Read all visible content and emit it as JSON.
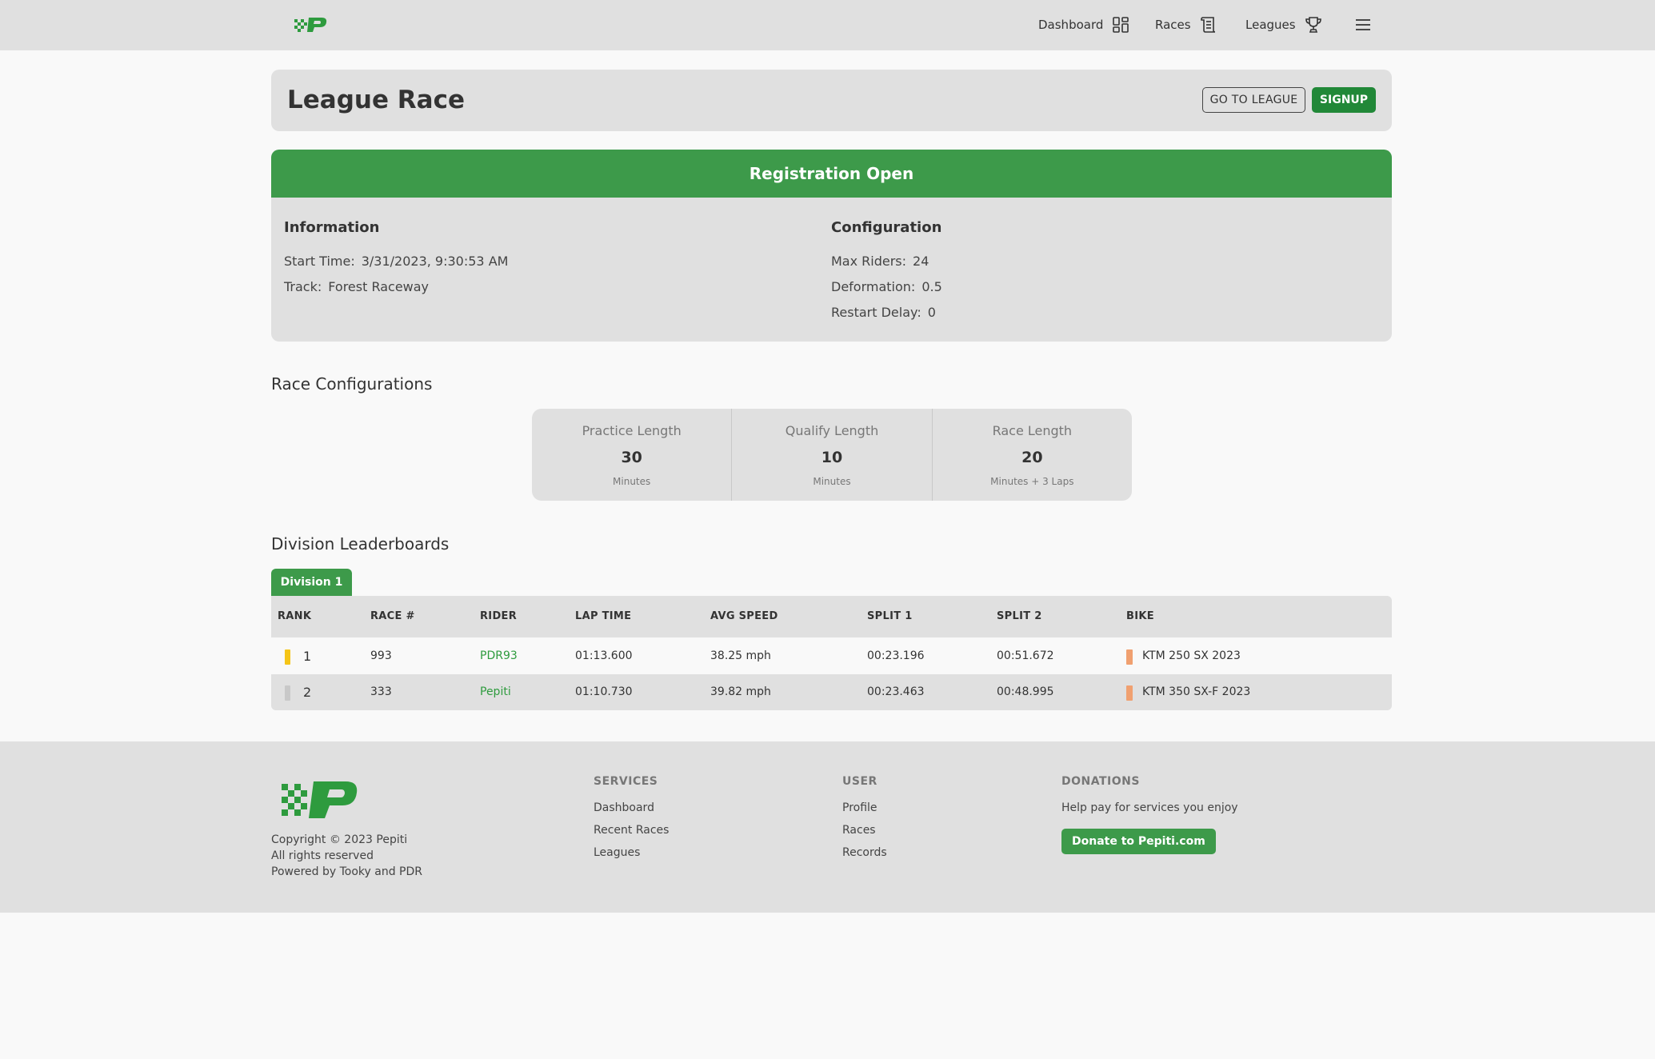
{
  "nav": {
    "logo": "pepiti-logo",
    "items": [
      {
        "label": "Dashboard",
        "icon": "dashboard-icon"
      },
      {
        "label": "Races",
        "icon": "scroll-icon"
      },
      {
        "label": "Leagues",
        "icon": "trophy-icon"
      }
    ],
    "menu_icon": "hamburger-menu-icon"
  },
  "header": {
    "title": "League Race",
    "go_to_league": "GO TO LEAGUE",
    "signup": "SIGNUP"
  },
  "registration": {
    "status": "Registration Open",
    "information": {
      "heading": "Information",
      "start_time_label": "Start Time:",
      "start_time": "3/31/2023, 9:30:53 AM",
      "track_label": "Track:",
      "track": "Forest Raceway"
    },
    "configuration": {
      "heading": "Configuration",
      "max_riders_label": "Max Riders:",
      "max_riders": "24",
      "deformation_label": "Deformation:",
      "deformation": "0.5",
      "restart_delay_label": "Restart Delay:",
      "restart_delay": "0"
    }
  },
  "race_configurations": {
    "title": "Race Configurations",
    "items": [
      {
        "label": "Practice Length",
        "value": "30",
        "unit": "Minutes"
      },
      {
        "label": "Qualify Length",
        "value": "10",
        "unit": "Minutes"
      },
      {
        "label": "Race Length",
        "value": "20",
        "unit": "Minutes + 3 Laps"
      }
    ]
  },
  "leaderboards": {
    "title": "Division Leaderboards",
    "active_tab": "Division 1",
    "columns": [
      "RANK",
      "RACE #",
      "RIDER",
      "LAP TIME",
      "AVG SPEED",
      "SPLIT 1",
      "SPLIT 2",
      "BIKE"
    ],
    "rows": [
      {
        "rank": "1",
        "rank_color": "#f5c518",
        "race_num": "993",
        "rider": "PDR93",
        "lap_time": "01:13.600",
        "avg_speed": "38.25 mph",
        "split1": "00:23.196",
        "split2": "00:51.672",
        "bike": "KTM 250 SX 2023"
      },
      {
        "rank": "2",
        "rank_color": "#c8c8c8",
        "race_num": "333",
        "rider": "Pepiti",
        "lap_time": "01:10.730",
        "avg_speed": "39.82 mph",
        "split1": "00:23.463",
        "split2": "00:48.995",
        "bike": "KTM 350 SX-F 2023"
      }
    ]
  },
  "footer": {
    "copyright": "Copyright © 2023 Pepiti",
    "rights": "All rights reserved",
    "powered": "Powered by Tooky and PDR",
    "services": {
      "heading": "SERVICES",
      "links": [
        "Dashboard",
        "Recent Races",
        "Leagues"
      ]
    },
    "user": {
      "heading": "USER",
      "links": [
        "Profile",
        "Races",
        "Records"
      ]
    },
    "donations": {
      "heading": "DONATIONS",
      "text": "Help pay for services you enjoy",
      "button": "Donate to Pepiti.com"
    }
  },
  "colors": {
    "brand_green": "#3d9a4a",
    "signup_green": "#218838",
    "link_green": "#2e9b3e",
    "bike_orange": "#f0a070"
  }
}
